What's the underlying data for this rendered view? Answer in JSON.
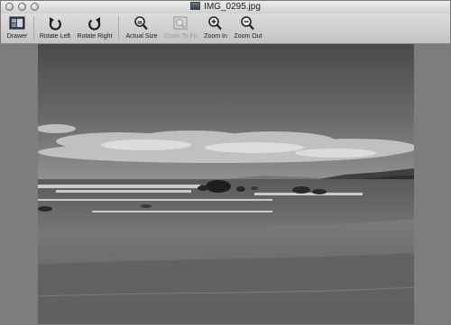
{
  "window": {
    "title": "IMG_0295.jpg"
  },
  "toolbar": {
    "items": [
      {
        "label": "Drawer",
        "icon": "drawer-icon",
        "enabled": true
      },
      {
        "label": "Rotate Left",
        "icon": "rotate-left-icon",
        "enabled": true
      },
      {
        "label": "Rotate Right",
        "icon": "rotate-right-icon",
        "enabled": true
      },
      {
        "label": "Actual Size",
        "icon": "actual-size-icon",
        "enabled": true
      },
      {
        "label": "Zoom To Fit",
        "icon": "zoom-to-fit-icon",
        "enabled": false
      },
      {
        "label": "Zoom In",
        "icon": "zoom-in-icon",
        "enabled": true
      },
      {
        "label": "Zoom Out",
        "icon": "zoom-out-icon",
        "enabled": true
      }
    ]
  },
  "image": {
    "description_icon": "beach-photo",
    "colors": {
      "sky": "#5e5e5e",
      "sand": "#6b6b6b",
      "margin": "#7d7d7d"
    }
  }
}
